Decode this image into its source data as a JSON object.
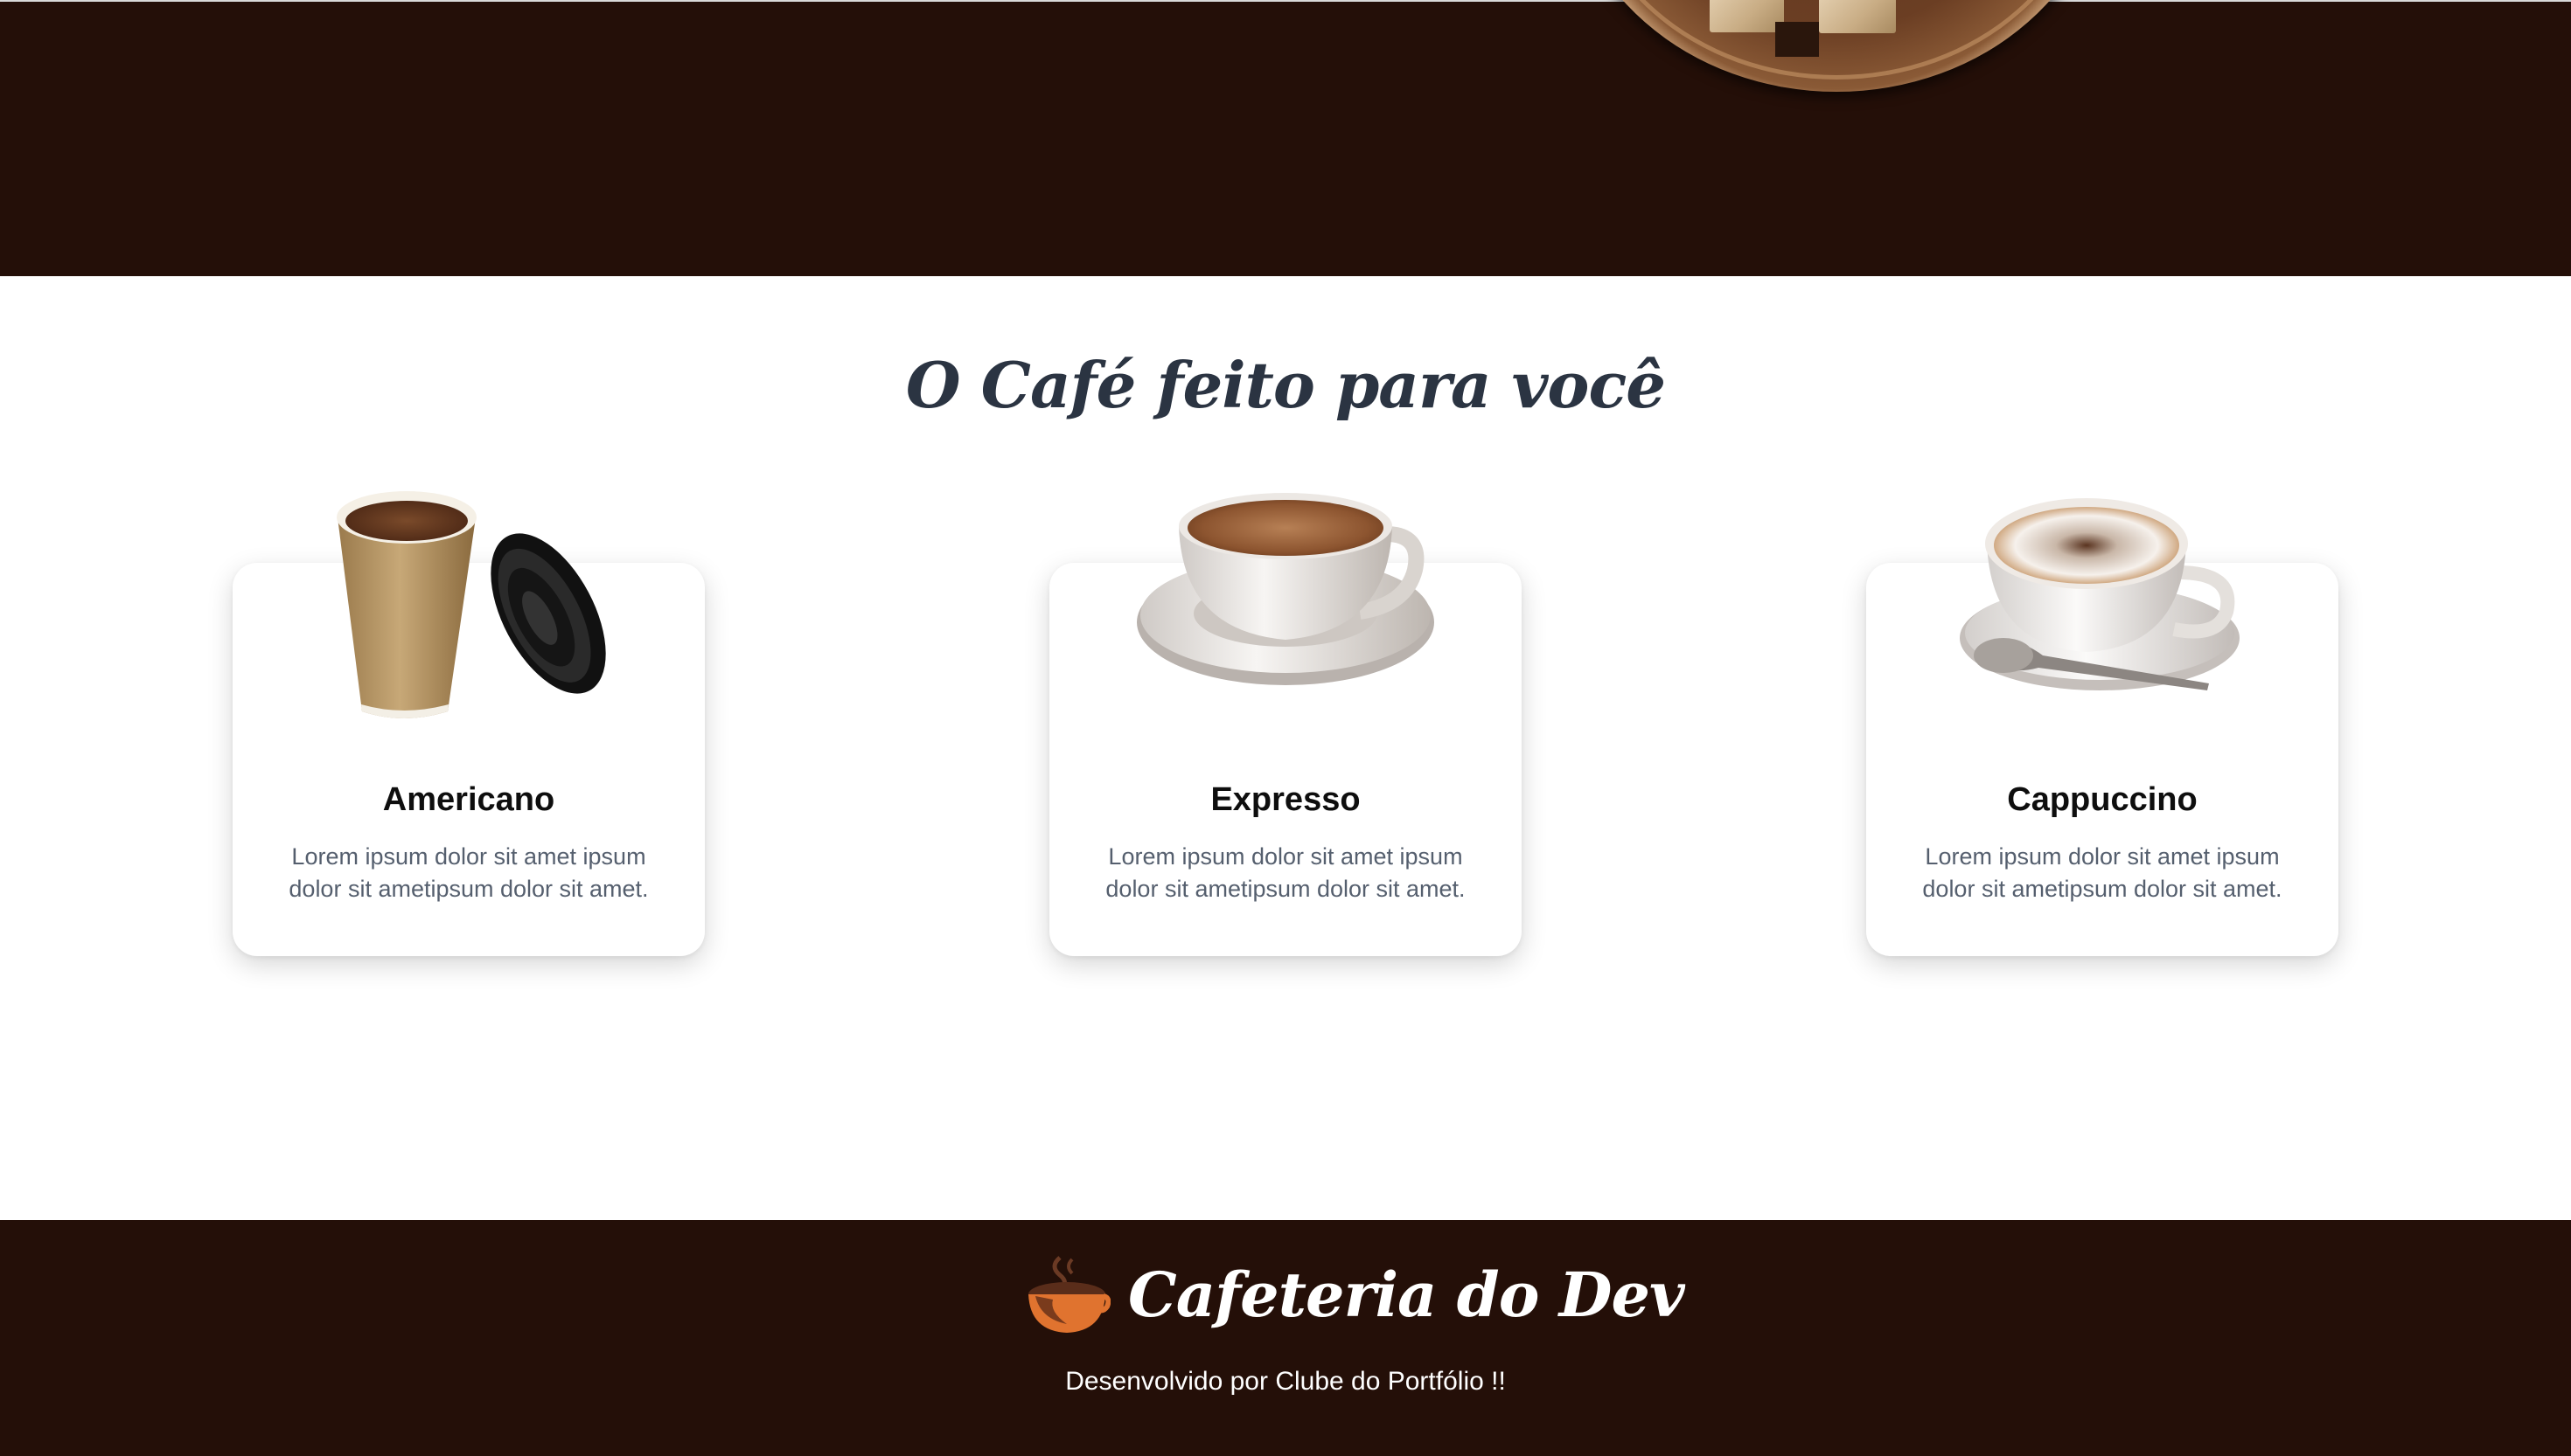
{
  "section": {
    "title": "O Café feito para você"
  },
  "products": [
    {
      "name": "Americano",
      "description": "Lorem ipsum dolor sit amet ipsum dolor sit ametipsum dolor sit amet.",
      "image_icon": "paper-coffee-cup-icon"
    },
    {
      "name": "Expresso",
      "description": "Lorem ipsum dolor sit amet ipsum dolor sit ametipsum dolor sit amet.",
      "image_icon": "espresso-cup-icon"
    },
    {
      "name": "Cappuccino",
      "description": "Lorem ipsum dolor sit amet ipsum dolor sit ametipsum dolor sit amet.",
      "image_icon": "cappuccino-cup-icon"
    }
  ],
  "footer": {
    "brand": "Cafeteria do Dev",
    "credit": "Desenvolvido por Clube do Portfólio !!",
    "logo_icon": "coffee-cup-logo-icon"
  },
  "colors": {
    "dark_brown": "#240f08",
    "title_slate": "#2b3442",
    "text_gray": "#555f6e",
    "logo_orange": "#e0732f"
  }
}
